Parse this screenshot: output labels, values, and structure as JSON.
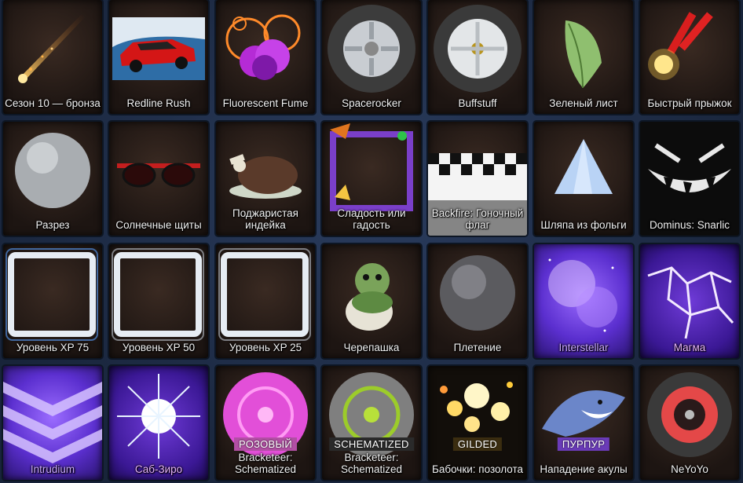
{
  "rows": [
    [
      {
        "name": "Сезон 10 — бронза",
        "icon": "bronze-rocket-trail-icon"
      },
      {
        "name": "Redline Rush",
        "icon": "red-car-decal-icon"
      },
      {
        "name": "Fluorescent Fume",
        "icon": "purple-smoke-icon"
      },
      {
        "name": "Spacerocker",
        "icon": "silver-wheel-icon"
      },
      {
        "name": "Buffstuff",
        "icon": "chrome-wheel-icon"
      },
      {
        "name": "Зеленый лист",
        "icon": "green-leaf-topper-icon"
      },
      {
        "name": "Быстрый прыжок",
        "icon": "firecracker-boost-icon"
      }
    ],
    [
      {
        "name": "Разрез",
        "icon": "silver-ball-icon"
      },
      {
        "name": "Солнечные щиты",
        "icon": "sunglasses-icon"
      },
      {
        "name": "Поджаристая индейка",
        "icon": "roast-turkey-topper-icon"
      },
      {
        "name": "Сладость или гадость",
        "icon": "halloween-frame-icon"
      },
      {
        "name": "Backfire: Гоночный флаг",
        "icon": "checkered-flag-icon"
      },
      {
        "name": "Шляпа из фольги",
        "icon": "foil-hat-icon"
      },
      {
        "name": "Dominus: Snarlic",
        "icon": "monster-mouth-decal-icon"
      }
    ],
    [
      {
        "name": "Уровень XP 75",
        "icon": "xp-frame-icon"
      },
      {
        "name": "Уровень XP 50",
        "icon": "xp-frame-icon"
      },
      {
        "name": "Уровень XP 25",
        "icon": "xp-frame-icon"
      },
      {
        "name": "Черепашка",
        "icon": "turtle-topper-icon"
      },
      {
        "name": "Плетение",
        "icon": "woven-ball-icon"
      },
      {
        "name": "Interstellar",
        "icon": "nebula-banner-icon"
      },
      {
        "name": "Магма",
        "icon": "cracked-magma-icon"
      }
    ],
    [
      {
        "name": "Intrudium",
        "icon": "chevron-banner-icon"
      },
      {
        "name": "Саб-Зиро",
        "icon": "ice-burst-icon"
      },
      {
        "name": "Bracketeer: Schematized",
        "badge": "РОЗОВЫЙ",
        "icon": "pink-wireframe-wheel-icon"
      },
      {
        "name": "Bracketeer: Schematized",
        "badge": "SCHEMATIZED",
        "icon": "green-wireframe-wheel-icon"
      },
      {
        "name": "Бабочки: позолота",
        "badge": "GILDED",
        "icon": "butterflies-icon"
      },
      {
        "name": "Нападение акулы",
        "badge": "ПУРПУР",
        "icon": "shark-topper-icon"
      },
      {
        "name": "NeYoYo",
        "icon": "red-yoyo-wheel-icon"
      }
    ]
  ]
}
